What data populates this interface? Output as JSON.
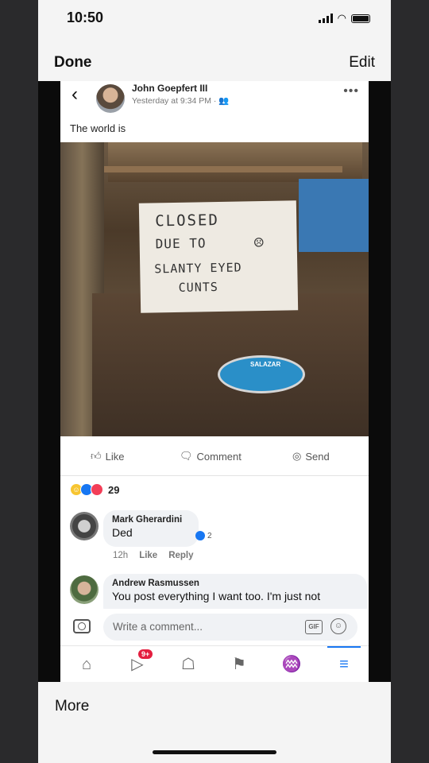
{
  "status_bar": {
    "time": "10:50"
  },
  "nav": {
    "done_label": "Done",
    "edit_label": "Edit"
  },
  "post": {
    "author": "John Goepfert III",
    "time": "Yesterday at 9:34 PM · 👥",
    "text": "The world is",
    "photo_sign": {
      "line1": "CLOSED",
      "line2": "DUE TO",
      "line3": "SLANTY EYED",
      "line4": "CUNTS",
      "face": "☹"
    },
    "sticker_text": "SALAZAR"
  },
  "actions": {
    "like": "Like",
    "comment": "Comment",
    "send": "Send"
  },
  "reactions": {
    "count": "29"
  },
  "comments": [
    {
      "author": "Mark Gherardini",
      "text": "Ded",
      "like_count": "2",
      "time": "12h",
      "like": "Like",
      "reply": "Reply"
    },
    {
      "author": "Andrew Rasmussen",
      "text": "You post everything I want too. I'm just not"
    }
  ],
  "composer": {
    "placeholder": "Write a comment...",
    "gif": "GIF"
  },
  "tabbar": {
    "video_badge": "9+"
  },
  "bottom": {
    "more_label": "More"
  },
  "icons": [
    "back-icon",
    "avatar",
    "more-icon",
    "like-icon",
    "comment-icon",
    "messenger-icon",
    "camera-icon",
    "gif-icon",
    "emoji-icon",
    "home-icon",
    "video-icon",
    "marketplace-icon",
    "flag-icon",
    "bell-icon",
    "menu-icon"
  ]
}
